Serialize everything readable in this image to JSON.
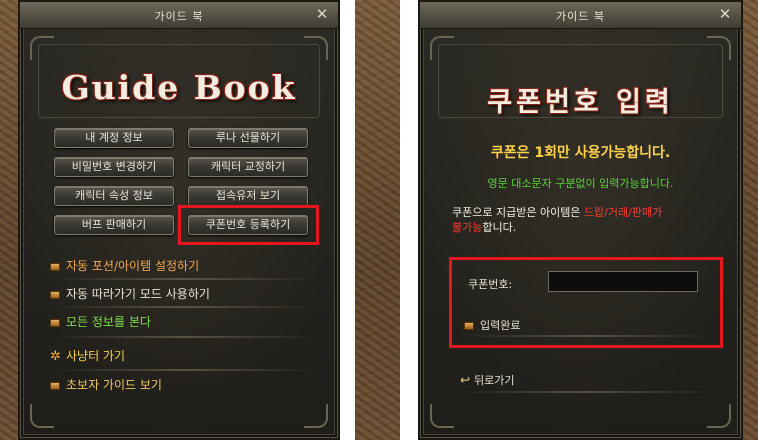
{
  "colors": {
    "accent_yellow": "#ffd24a",
    "notice_green": "#5ad23a",
    "warning_red": "#ff3a2e",
    "highlight_red": "#e3181c",
    "menu_orange": "#f0a850"
  },
  "left": {
    "window_title": "가이드 북",
    "close_icon": "close-icon",
    "heading": "Guide Book",
    "buttons": [
      "내 계정 정보",
      "루나 선물하기",
      "비밀번호 변경하기",
      "캐릭터 교정하기",
      "캐릭터 속성 정보",
      "접속유저 보기",
      "버프 판매하기",
      "쿠폰번호 등록하기"
    ],
    "menu": {
      "auto_potion": "자동 포션/아이템 설정하기",
      "auto_follow": "자동 따라가기 모드 사용하기",
      "show_all": "모든 정보를 본다",
      "hunting": "사냥터 가기",
      "beginner": "초보자 가이드 보기"
    }
  },
  "right": {
    "window_title": "가이드 북",
    "close_icon": "close-icon",
    "heading": "쿠폰번호 입력",
    "notice_main": "쿠폰은 1회만 사용가능합니다.",
    "notice_case": "영문 대소문자 구분없이 입력가능합니다.",
    "desc_prefix": "쿠폰으로 지급받은 아이템은 ",
    "desc_red_1": "드랍/거래/판매가",
    "desc_red_2": "불가능",
    "desc_suffix": "합니다.",
    "coupon_label": "쿠폰번호:",
    "coupon_value": "",
    "submit_label": "입력완료",
    "back_label": "뒤로가기"
  }
}
